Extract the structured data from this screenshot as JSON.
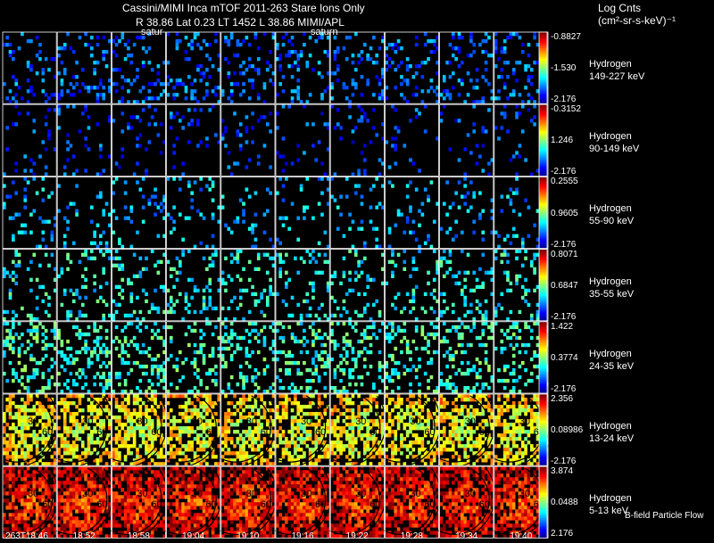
{
  "header": {
    "title_line1": "Cassini/MIMI Inca mTOF  2011-263   Stare   Ions Only",
    "title_line2": "R          38.86 Lat 0.23 LT 1452 L          38.86  MIMI/APL",
    "legend_title": "Log Cnts",
    "legend_unit": "(cm²-sr-s-keV)⁻¹"
  },
  "labels": {
    "saturn_left": "satur",
    "saturn_right": "saturn",
    "bfield": "B-field Particle Flow"
  },
  "chart_data": {
    "type": "heatmap",
    "time_labels": [
      "263T18:46",
      "18:52",
      "18:58",
      "19:04",
      "19:10",
      "19:16",
      "19:22",
      "19:28",
      "19:34",
      "19:40"
    ],
    "rows": [
      {
        "species": "Hydrogen",
        "energy": "149-227 keV",
        "max": "-0.8827",
        "mid": "-1.530",
        "min": "-2.176"
      },
      {
        "species": "Hydrogen",
        "energy": "90-149 keV",
        "max": "-0.3152",
        "mid": "1.246",
        "min": "-2.176"
      },
      {
        "species": "Hydrogen",
        "energy": "55-90 keV",
        "max": "0.2555",
        "mid": "0.9605",
        "min": "-2.176"
      },
      {
        "species": "Hydrogen",
        "energy": "35-55 keV",
        "max": "0.8071",
        "mid": "0.6847",
        "min": "-2.176"
      },
      {
        "species": "Hydrogen",
        "energy": "24-35 keV",
        "max": "1.422",
        "mid": "0.3774",
        "min": "-2.176"
      },
      {
        "species": "Hydrogen",
        "energy": "13-24 keV",
        "max": "2.356",
        "mid": "0.08986",
        "min": "-2.176"
      },
      {
        "species": "Hydrogen",
        "energy": "5-13 keV",
        "max": "3.874",
        "mid": "0.0488",
        "min": "2.176"
      }
    ],
    "row_fill_level": [
      0.18,
      0.08,
      0.1,
      0.16,
      0.26,
      0.7,
      0.9
    ],
    "row_color_level": [
      0.22,
      0.18,
      0.3,
      0.38,
      0.42,
      0.55,
      0.8
    ],
    "contour_labels": [
      "30",
      "60"
    ]
  }
}
